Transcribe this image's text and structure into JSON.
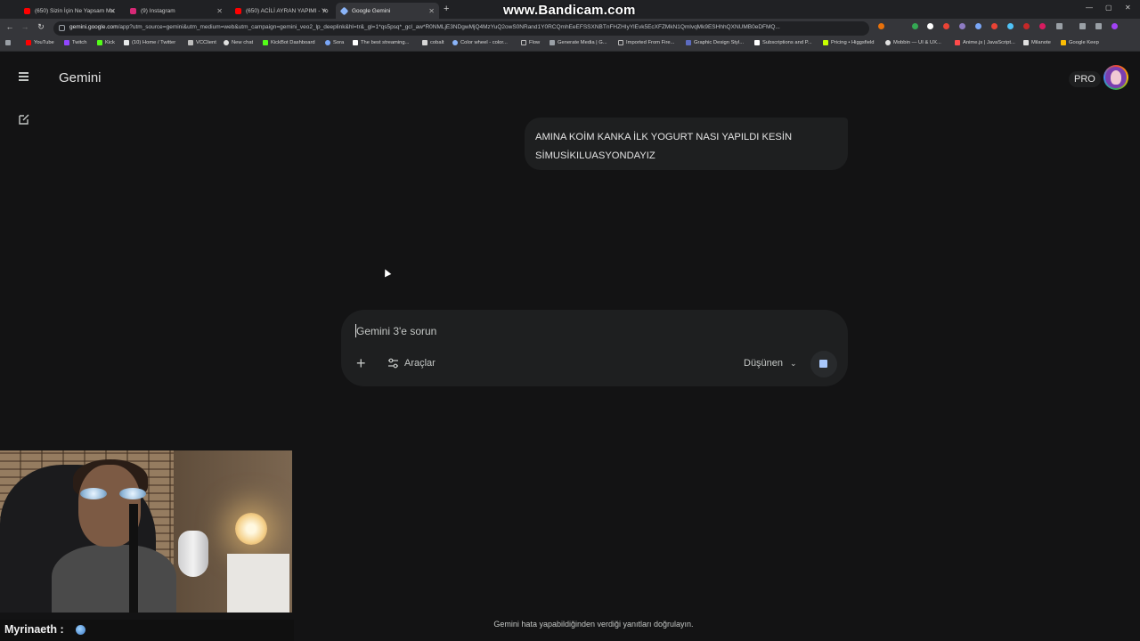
{
  "watermark": "www.Bandicam.com",
  "browser": {
    "tabs": [
      {
        "title": "(650) Sizin İçin Ne Yapsam Mu",
        "color": "#ff0000"
      },
      {
        "title": "(9) Instagram",
        "color": "#d62976"
      },
      {
        "title": "(650) ACİLİ AYRAN YAPIMI - Yo",
        "color": "#ff0000"
      },
      {
        "title": "Google Gemini",
        "color": "#8ab4f8",
        "active": true
      }
    ],
    "address_host": "gemini.google.com",
    "address_path": "/app?utm_source=gemini&utm_medium=web&utm_campaign=gemini_veo2_lp_deeplink&hl=tr&_gl=1*qs5psq*_gcl_aw*R0NMLjE3NDgwMjQ4MzYuQ2owS0NRand1Y0RCQmhEeEFSSXNBTnFHZHIyYlEvk5EcXFZMkN1QmlvqMk9ESHhhQXNUMB0eDFMQ...",
    "bookmarks": [
      "YouTube",
      "Twitch",
      "Kick",
      "(10) Home / Twitter",
      "VCClient",
      "New chat",
      "KickBot Dashboard",
      "Sora",
      "The best streaming...",
      "cobalt",
      "Color wheel - color...",
      "Flow",
      "Generate Media | G...",
      "Imported From Fire...",
      "Graphic Design Styl...",
      "Subscriptions and P...",
      "Pricing • Higgsfield",
      "Mobbin — UI & UX...",
      "Anime.js | JavaScript...",
      "Milanote",
      "Google Keep"
    ]
  },
  "app": {
    "title": "Gemini",
    "plan_badge": "PRO",
    "user_message_line1": "AMINA KOİM KANKA İLK YOGURT NASI YAPILDI KESİN",
    "user_message_line2": "SİMUSİKILUASYONDAYIZ",
    "composer": {
      "placeholder": "Gemini 3'e sorun",
      "tools_label": "Araçlar",
      "mode_label": "Düşünen"
    },
    "disclaimer": "Gemini hata yapabildiğinden verdiği yanıtları doğrulayın."
  },
  "overlay": {
    "streamer_name": "Myrinaeth :"
  },
  "colors": {
    "background": "#131314",
    "surface": "#1e1f20",
    "text": "#e3e3e3",
    "accent": "#a8c7fa"
  }
}
